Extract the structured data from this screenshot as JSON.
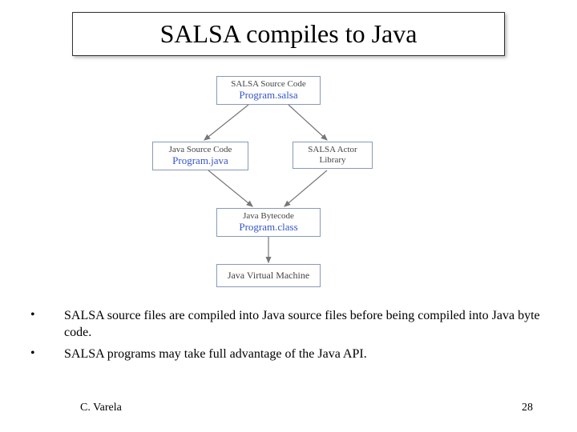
{
  "title": "SALSA compiles to Java",
  "diagram": {
    "source": {
      "label": "SALSA Source Code",
      "file": "Program.salsa"
    },
    "java": {
      "label": "Java Source Code",
      "file": "Program.java"
    },
    "lib": {
      "label": "SALSA Actor Library"
    },
    "byte": {
      "label": "Java Bytecode",
      "file": "Program.class"
    },
    "jvm": {
      "label": "Java Virtual Machine"
    }
  },
  "bullets": [
    "SALSA source files are compiled into Java source files before being compiled into Java byte code.",
    "SALSA programs may take full advantage of the Java API."
  ],
  "footer": {
    "author": "C. Varela",
    "page": "28"
  }
}
